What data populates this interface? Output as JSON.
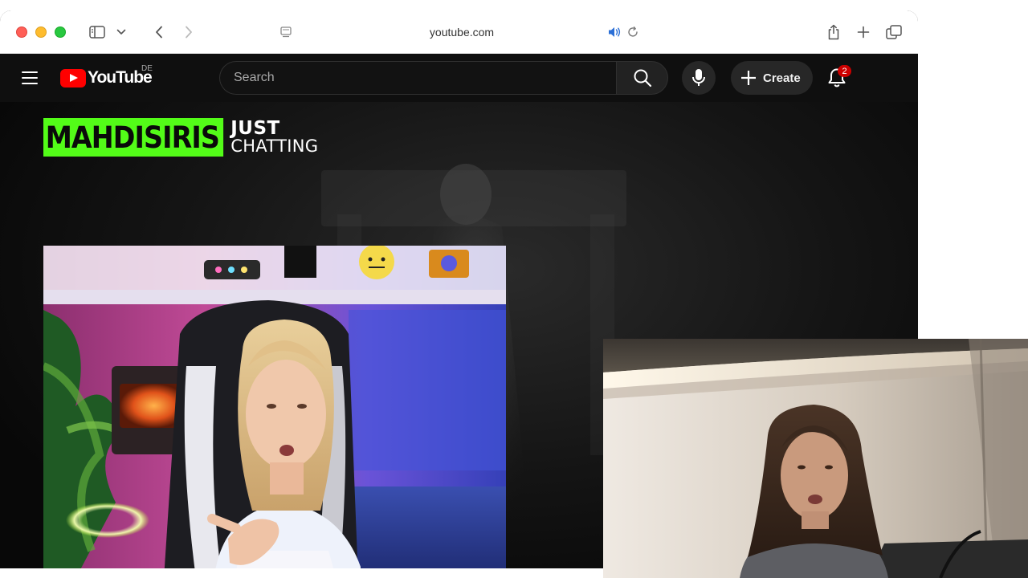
{
  "browser": {
    "url": "youtube.com",
    "icons": {
      "sidebar": "sidebar-icon",
      "back": "chevron-left-icon",
      "forward": "chevron-right-icon",
      "tab": "tab-icon",
      "audio": "speaker-icon",
      "reload": "reload-icon",
      "share": "share-icon",
      "new_tab": "plus-icon",
      "tabs_overview": "tabs-icon"
    }
  },
  "youtube": {
    "logo_text": "YouTube",
    "region": "DE",
    "search": {
      "placeholder": "Search"
    },
    "create_label": "Create",
    "notification_count": "2"
  },
  "video": {
    "channel_name": "MAHDISIRIS",
    "category_line1": "JUST",
    "category_line2": "CHATTING"
  },
  "colors": {
    "youtube_red": "#ff0000",
    "kick_green": "#53fc18",
    "header_bg": "#0f0f0f",
    "badge_red": "#cc0000"
  }
}
